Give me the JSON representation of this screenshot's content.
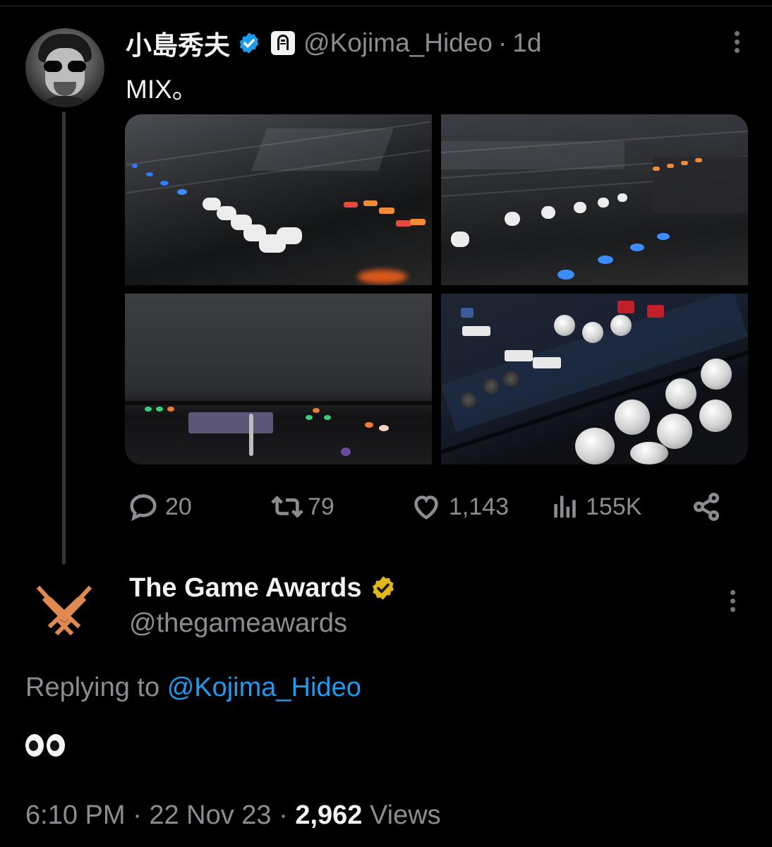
{
  "tweet": {
    "author_name": "小島秀夫",
    "handle": "@Kojima_Hideo",
    "separator": "·",
    "time_ago": "1d",
    "text": "MIX。",
    "verified": "blue-check",
    "affiliate_badge": "kojima-productions-logo",
    "media": [
      "mixing-console-photo-1",
      "mixing-console-photo-2",
      "mixing-console-photo-3",
      "mixing-console-photo-4"
    ],
    "actions": {
      "replies": "20",
      "reposts": "79",
      "likes": "1,143",
      "views": "155K"
    }
  },
  "reply": {
    "author_name": "The Game Awards",
    "handle": "@thegameawards",
    "verified": "gold-check",
    "replying_to_label": "Replying to",
    "replying_to_handle": "@Kojima_Hideo",
    "text_emoji": "eyes-emoji",
    "time": "6:10 PM",
    "date": "22 Nov 23",
    "separator": "·",
    "views_count": "2,962",
    "views_label": "Views"
  },
  "colors": {
    "background": "#000000",
    "text": "#e7e9ea",
    "secondary_text": "#8a8d91",
    "link": "#1d9bf0",
    "verified_blue": "#1d9bf0",
    "verified_gold": "#e2b719",
    "tga_orange": "#e08a52"
  }
}
